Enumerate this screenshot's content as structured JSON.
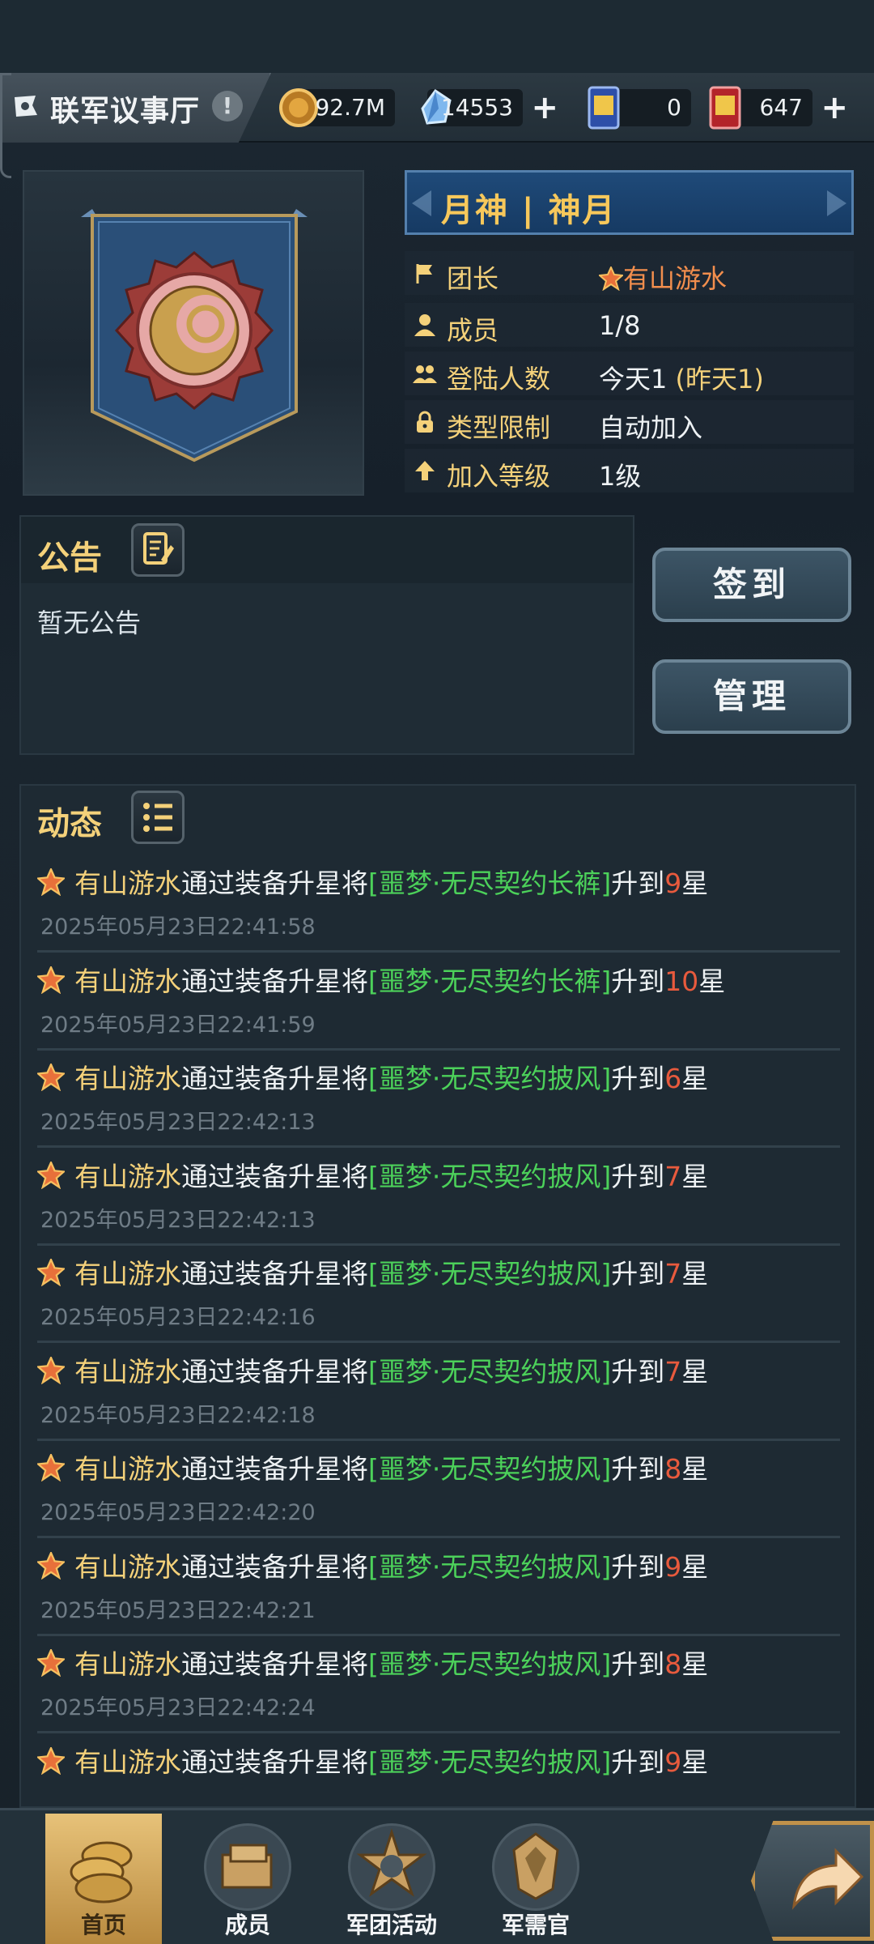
{
  "header": {
    "title": "联军议事厅",
    "resources": [
      {
        "name": "gold",
        "icon": "gold-coin-icon",
        "value": "92.7M",
        "has_plus": false
      },
      {
        "name": "crystal",
        "icon": "crystal-icon",
        "value": "14553",
        "has_plus": true
      },
      {
        "name": "ticket_dai",
        "icon": "dai-ticket-icon",
        "value": "0",
        "has_plus": false
      },
      {
        "name": "ticket_jin",
        "icon": "jin-ticket-icon",
        "value": "647",
        "has_plus": true
      }
    ]
  },
  "guild": {
    "name": "月神 | 神月",
    "rows": [
      {
        "icon": "flag-icon",
        "label": "团长",
        "value": "有山游水"
      },
      {
        "icon": "person-icon",
        "label": "成员",
        "value": "1/8"
      },
      {
        "icon": "group-icon",
        "label": "登陆人数",
        "value_main": "今天1",
        "value_extra": "(昨天1)"
      },
      {
        "icon": "lock-icon",
        "label": "类型限制",
        "value": "自动加入"
      },
      {
        "icon": "arrow-up-icon",
        "label": "加入等级",
        "value": "1级"
      }
    ]
  },
  "notice": {
    "title": "公告",
    "body": "暂无公告"
  },
  "buttons": {
    "checkin": "签到",
    "manage": "管理"
  },
  "feed": {
    "title": "动态",
    "items": [
      {
        "who": "有山游水",
        "mid": "通过装备升星将",
        "item": "[噩梦·无尽契约长裤]",
        "up": "升到",
        "level": "9",
        "unit": "星",
        "time": "2025年05月23日22:41:58"
      },
      {
        "who": "有山游水",
        "mid": "通过装备升星将",
        "item": "[噩梦·无尽契约长裤]",
        "up": "升到",
        "level": "10",
        "unit": "星",
        "time": "2025年05月23日22:41:59"
      },
      {
        "who": "有山游水",
        "mid": "通过装备升星将",
        "item": "[噩梦·无尽契约披风]",
        "up": "升到",
        "level": "6",
        "unit": "星",
        "time": "2025年05月23日22:42:13"
      },
      {
        "who": "有山游水",
        "mid": "通过装备升星将",
        "item": "[噩梦·无尽契约披风]",
        "up": "升到",
        "level": "7",
        "unit": "星",
        "time": "2025年05月23日22:42:13"
      },
      {
        "who": "有山游水",
        "mid": "通过装备升星将",
        "item": "[噩梦·无尽契约披风]",
        "up": "升到",
        "level": "7",
        "unit": "星",
        "time": "2025年05月23日22:42:16"
      },
      {
        "who": "有山游水",
        "mid": "通过装备升星将",
        "item": "[噩梦·无尽契约披风]",
        "up": "升到",
        "level": "7",
        "unit": "星",
        "time": "2025年05月23日22:42:18"
      },
      {
        "who": "有山游水",
        "mid": "通过装备升星将",
        "item": "[噩梦·无尽契约披风]",
        "up": "升到",
        "level": "8",
        "unit": "星",
        "time": "2025年05月23日22:42:20"
      },
      {
        "who": "有山游水",
        "mid": "通过装备升星将",
        "item": "[噩梦·无尽契约披风]",
        "up": "升到",
        "level": "9",
        "unit": "星",
        "time": "2025年05月23日22:42:21"
      },
      {
        "who": "有山游水",
        "mid": "通过装备升星将",
        "item": "[噩梦·无尽契约披风]",
        "up": "升到",
        "level": "8",
        "unit": "星",
        "time": "2025年05月23日22:42:24"
      },
      {
        "who": "有山游水",
        "mid": "通过装备升星将",
        "item": "[噩梦·无尽契约披风]",
        "up": "升到",
        "level": "9",
        "unit": "星",
        "time": ""
      }
    ]
  },
  "nav": {
    "items": [
      {
        "label": "首页",
        "icon": "coins-icon",
        "active": true
      },
      {
        "label": "成员",
        "icon": "members-icon",
        "active": false
      },
      {
        "label": "军团活动",
        "icon": "star-emblem-icon",
        "active": false
      },
      {
        "label": "军需官",
        "icon": "quartermaster-icon",
        "active": false
      }
    ],
    "back_icon": "return-arrow-icon"
  },
  "colors": {
    "accent_gold": "#f4d17a",
    "leader_orange": "#f28e4d",
    "item_green": "#4cd15a",
    "level_red": "#e85a3d"
  }
}
